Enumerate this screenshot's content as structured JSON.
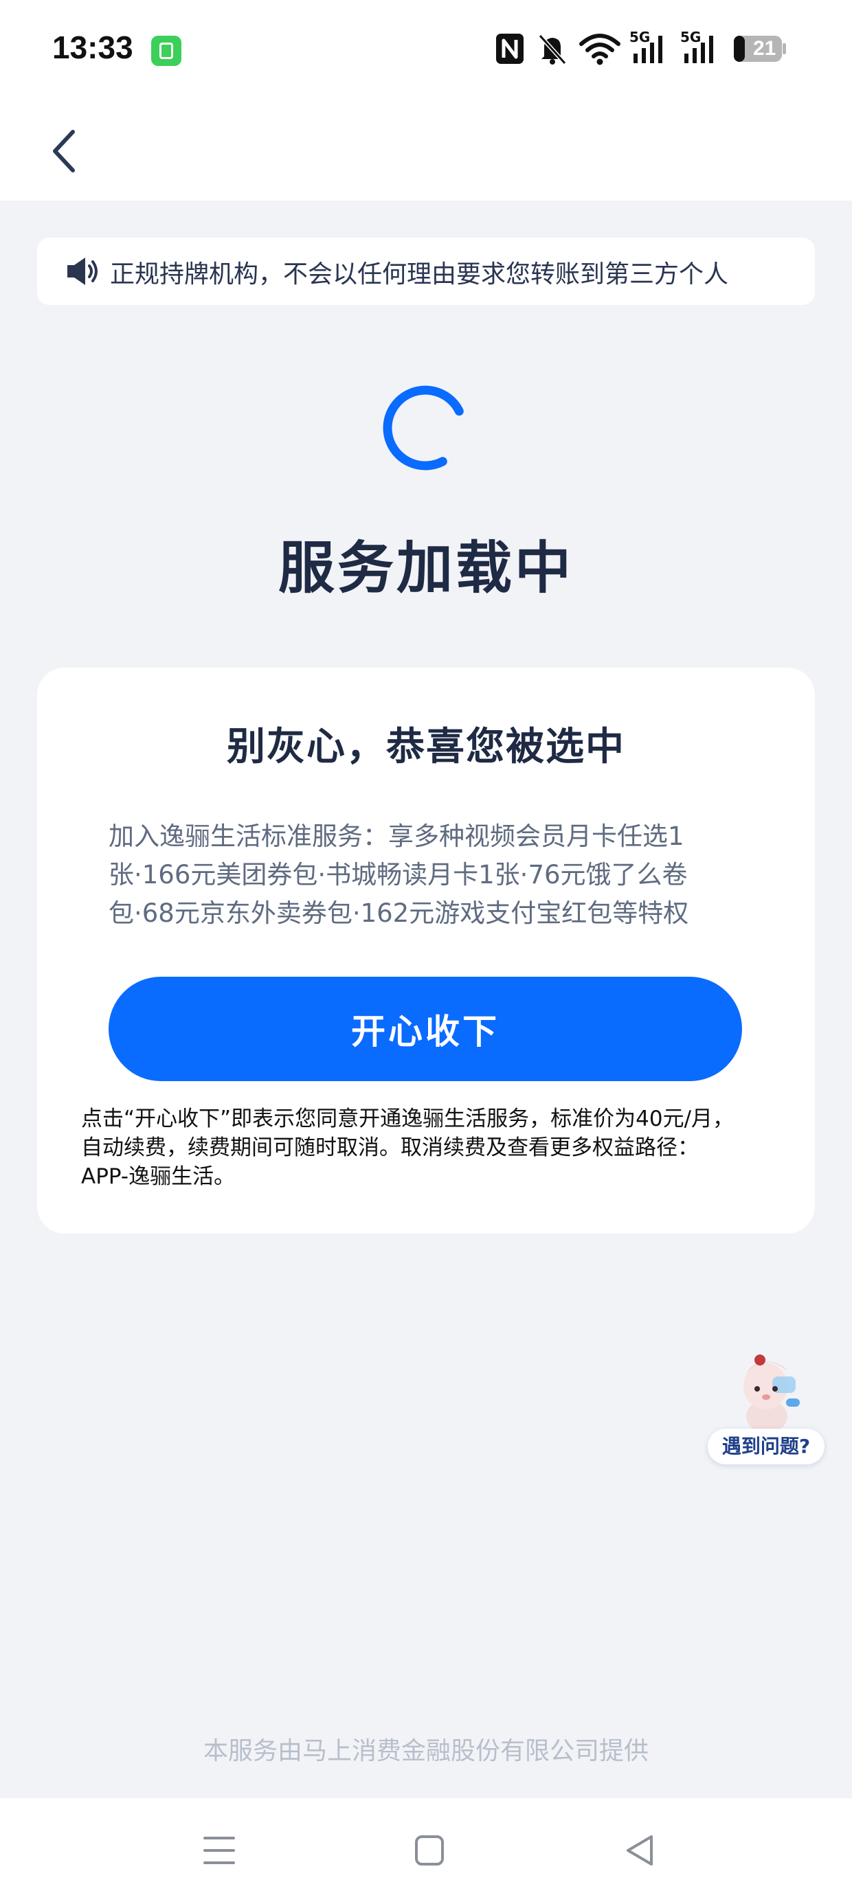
{
  "status_bar": {
    "time": "13:33",
    "battery_level": "21",
    "network_1": "5G",
    "network_2": "5G",
    "icons": [
      "nfc-icon",
      "mute-icon",
      "wifi-icon",
      "signal-icon",
      "signal-icon",
      "battery-icon"
    ]
  },
  "nav": {
    "back_icon": "chevron-left-icon"
  },
  "notice": {
    "icon": "speaker-icon",
    "text": "正规持牌机构，不会以任何理由要求您转账到第三方个人"
  },
  "loading": {
    "title": "服务加载中"
  },
  "card": {
    "title": "别灰心，恭喜您被选中",
    "description_lines": [
      "加入逸骊生活标准服务：享多种视频会员月卡任选1",
      "张·166元美团券包·书城畅读月卡1张·76元饿了么卷",
      "包·68元京东外卖券包·162元游戏支付宝红包等特权"
    ],
    "button_label": "开心收下",
    "terms_lines": [
      "点击“开心收下”即表示您同意开通逸骊生活服务，标准价为40元/月，",
      "自动续费，续费期间可随时取消。取消续费及查看更多权益路径：",
      "APP-逸骊生活。"
    ]
  },
  "help": {
    "label": "遇到问题?"
  },
  "footer": {
    "text": "本服务由马上消费金融股份有限公司提供"
  },
  "colors": {
    "accent": "#0a6bff",
    "background": "#f2f3f7",
    "title": "#1f2a44",
    "muted": "#b8bfcb"
  }
}
